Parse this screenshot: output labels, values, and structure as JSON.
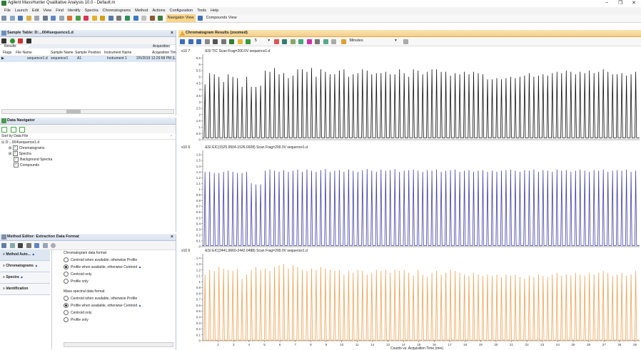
{
  "app": {
    "title": "Agilent MassHunter Qualitative Analysis 10.0 - Default.m",
    "minimize": "–",
    "restore": "❐",
    "close": "✕"
  },
  "menu": [
    "File",
    "Launch",
    "Edit",
    "View",
    "Find",
    "Identify",
    "Spectra",
    "Chromatograms",
    "Method",
    "Actions",
    "Configuration",
    "Tools",
    "Help"
  ],
  "toolbar": {
    "navigator_view": "Navigator View",
    "compounds_view": "Compounds View"
  },
  "sample_table": {
    "title": "Sample Table: D:...004\\sequence1.d",
    "group_results": "Results",
    "group_acquisition": "Acquisition",
    "columns": [
      "Flags",
      "File Name",
      "Sample Name",
      "Sample Position",
      "Instrument Name",
      "Acquisition Tim"
    ],
    "rows": [
      [
        "",
        "sequence1.d",
        "sequence1",
        "A1",
        "Instrument 1",
        "2/5/2019 12:29:58 PM (L"
      ]
    ]
  },
  "data_navigator": {
    "title": "Data Navigator",
    "sort_label": "Sort by Data File",
    "root": "D:...004\\sequence1.d",
    "items": [
      "Chromatograms",
      "Spectra",
      "Background Spectra",
      "Compounds"
    ]
  },
  "method_editor": {
    "title": "Method Editor: Extraction Data Format",
    "nav": [
      "Method Auto...",
      "Chromatograms",
      "Spectra",
      "Identification"
    ],
    "chrom_section": "Chromatogram data format",
    "chrom_options": [
      "Centroid when available, otherwise Profile",
      "Profile when available, otherwise Centroid",
      "Centroid only",
      "Profile only"
    ],
    "chrom_selected": 1,
    "ms_section": "Mass spectral data format",
    "ms_options": [
      "Centroid when available, otherwise Profile",
      "Profile when available, otherwise Centroid",
      "Centroid only",
      "Profile only"
    ],
    "ms_selected": 1
  },
  "chromatogram": {
    "title": "Chromatogram Results (zoomed)",
    "toolbar_number": "5",
    "units_dropdown": "Minutes",
    "x_axis_title": "Counts vs. Acquisition Time (min)",
    "x_ticks": [
      "2",
      "3",
      "4",
      "5",
      "6",
      "7",
      "8",
      "9",
      "10",
      "11",
      "12",
      "13",
      "14",
      "15",
      "16",
      "17",
      "18",
      "19",
      "20",
      "21",
      "22",
      "23",
      "24",
      "25",
      "26",
      "27",
      "28",
      "29"
    ],
    "x_range": [
      1.0,
      29.3
    ]
  },
  "chart_data": [
    {
      "type": "line",
      "title": "-ESI TIC Scan Frag=200.0V sequence1.d",
      "exponent": "x10 7",
      "color": "#111111",
      "y_ticks": [
        "0",
        "0.5",
        "1",
        "1.5",
        "2",
        "2.5",
        "3",
        "3.5",
        "4",
        "4.5",
        "5",
        "5.5",
        "6",
        "6.5"
      ],
      "ylim": [
        0,
        6.7
      ],
      "peak_x": [
        1.15,
        1.45,
        1.75,
        2.05,
        2.35,
        2.65,
        2.95,
        3.25,
        3.55,
        3.85,
        4.15,
        4.45,
        4.75,
        5.05,
        5.35,
        5.65,
        5.95,
        6.25,
        6.55,
        6.85,
        7.15,
        7.45,
        7.75,
        8.05,
        8.35,
        8.65,
        8.95,
        9.25,
        9.55,
        9.85,
        10.15,
        10.45,
        10.75,
        11.05,
        11.35,
        11.65,
        11.95,
        12.25,
        12.55,
        12.85,
        13.15,
        13.45,
        13.75,
        14.05,
        14.35,
        14.65,
        14.95,
        15.25,
        15.55,
        15.85,
        16.15,
        16.45,
        16.75,
        17.05,
        17.35,
        17.65,
        17.95,
        18.25,
        18.55,
        18.85,
        19.15,
        19.45,
        19.75,
        20.05,
        20.35,
        20.65,
        20.95,
        21.25,
        21.55,
        21.85,
        22.15,
        22.45,
        22.75,
        23.05,
        23.35,
        23.65,
        23.95,
        24.25,
        24.55,
        24.85,
        25.15,
        25.45,
        25.75,
        26.05,
        26.35,
        26.65,
        26.95,
        27.25,
        27.55,
        27.85,
        28.15,
        28.45,
        28.75,
        29.05
      ],
      "peak_y": [
        4.4,
        5.3,
        5.2,
        5.0,
        4.6,
        5.2,
        5.0,
        4.9,
        4.2,
        5.0,
        4.2,
        4.2,
        4.3,
        5.5,
        5.4,
        5.7,
        5.2,
        5.3,
        4.9,
        5.1,
        5.6,
        5.6,
        5.4,
        5.7,
        5.0,
        5.6,
        5.4,
        5.2,
        5.2,
        5.5,
        5.6,
        5.0,
        5.2,
        5.3,
        5.6,
        5.5,
        5.2,
        5.3,
        5.3,
        5.4,
        5.2,
        5.2,
        5.6,
        5.3,
        5.0,
        5.6,
        5.5,
        5.2,
        5.4,
        5.6,
        5.6,
        5.4,
        5.4,
        5.1,
        5.3,
        5.2,
        5.4,
        5.2,
        5.4,
        5.3,
        5.2,
        4.8,
        4.8,
        4.9,
        4.8,
        4.9,
        5.0,
        4.9,
        5.0,
        5.1,
        5.3,
        5.0,
        5.1,
        5.2,
        5.1,
        5.3,
        5.4,
        5.3,
        5.5,
        5.4,
        5.2,
        5.4,
        5.3,
        5.5,
        5.3,
        5.4,
        5.6,
        5.4,
        5.2,
        5.2,
        5.3,
        5.1,
        5.2,
        5.4
      ],
      "baseline": 0.15
    },
    {
      "type": "line",
      "title": "-ESI EIC(1525.9504-1526.0928) Scan Frag=200.0V sequence1.d",
      "exponent": "x10 6",
      "color": "#3f3fa8",
      "y_ticks": [
        "0",
        "0.1",
        "0.2",
        "0.3",
        "0.4",
        "0.5",
        "0.6",
        "0.7",
        "0.8",
        "0.9",
        "1",
        "1.1",
        "1.2",
        "1.3",
        "1.4",
        "1.5",
        "1.6"
      ],
      "ylim": [
        0,
        1.65
      ],
      "peak_x": [
        1.15,
        1.45,
        1.75,
        2.05,
        2.35,
        2.65,
        2.95,
        3.25,
        3.55,
        3.85,
        4.15,
        4.45,
        4.75,
        5.05,
        5.35,
        5.65,
        5.95,
        6.25,
        6.55,
        6.85,
        7.15,
        7.45,
        7.75,
        8.05,
        8.35,
        8.65,
        8.95,
        9.25,
        9.55,
        9.85,
        10.15,
        10.45,
        10.75,
        11.05,
        11.35,
        11.65,
        11.95,
        12.25,
        12.55,
        12.85,
        13.15,
        13.45,
        13.75,
        14.05,
        14.35,
        14.65,
        14.95,
        15.25,
        15.55,
        15.85,
        16.15,
        16.45,
        16.75,
        17.05,
        17.35,
        17.65,
        17.95,
        18.25,
        18.55,
        18.85,
        19.15,
        19.45,
        19.75,
        20.05,
        20.35,
        20.65,
        20.95,
        21.25,
        21.55,
        21.85,
        22.15,
        22.45,
        22.75,
        23.05,
        23.35,
        23.65,
        23.95,
        24.25,
        24.55,
        24.85,
        25.15,
        25.45,
        25.75,
        26.05,
        26.35,
        26.65,
        26.95,
        27.25,
        27.55,
        27.85,
        28.15,
        28.45,
        28.75,
        29.05
      ],
      "peak_y": [
        1.3,
        1.3,
        1.28,
        1.28,
        1.3,
        1.32,
        1.3,
        1.28,
        1.28,
        1.3,
        1.1,
        1.08,
        1.08,
        1.32,
        1.34,
        1.32,
        1.3,
        1.33,
        1.3,
        1.32,
        1.34,
        1.3,
        1.34,
        1.32,
        1.3,
        1.33,
        1.35,
        1.3,
        1.32,
        1.33,
        1.3,
        1.34,
        1.32,
        1.3,
        1.33,
        1.35,
        1.32,
        1.3,
        1.34,
        1.32,
        1.33,
        1.35,
        1.3,
        1.32,
        1.33,
        1.34,
        1.32,
        1.3,
        1.33,
        1.32,
        1.34,
        1.3,
        1.32,
        1.33,
        1.34,
        1.3,
        1.32,
        1.33,
        1.3,
        1.32,
        1.33,
        1.3,
        1.32,
        1.3,
        1.32,
        1.33,
        1.34,
        1.32,
        1.3,
        1.33,
        1.32,
        1.34,
        1.3,
        1.33,
        1.32,
        1.3,
        1.34,
        1.32,
        1.33,
        1.3,
        1.32,
        1.34,
        1.32,
        1.3,
        1.33,
        1.32,
        1.34,
        1.3,
        1.32,
        1.33,
        1.32,
        1.34,
        1.3,
        1.32
      ],
      "baseline": 0.02
    },
    {
      "type": "line",
      "title": "-ESI EIC(2441.9660-2442.0488) Scan Frag=200.0V sequence1.d",
      "exponent": "x10 6",
      "color": "#f0a050",
      "y_ticks": [
        "0",
        "0.1",
        "0.2",
        "0.3",
        "0.4",
        "0.5",
        "0.6",
        "0.7",
        "0.8",
        "0.9",
        "1",
        "1.1",
        "1.2",
        "1.3",
        "1.4"
      ],
      "ylim": [
        0,
        1.45
      ],
      "peak_x": [
        1.15,
        1.45,
        1.75,
        2.05,
        2.35,
        2.65,
        2.95,
        3.25,
        3.55,
        3.85,
        4.15,
        4.45,
        4.75,
        5.05,
        5.35,
        5.65,
        5.95,
        6.25,
        6.55,
        6.85,
        7.15,
        7.45,
        7.75,
        8.05,
        8.35,
        8.65,
        8.95,
        9.25,
        9.55,
        9.85,
        10.15,
        10.45,
        10.75,
        11.05,
        11.35,
        11.65,
        11.95,
        12.25,
        12.55,
        12.85,
        13.15,
        13.45,
        13.75,
        14.05,
        14.35,
        14.65,
        14.95,
        15.25,
        15.55,
        15.85,
        16.15,
        16.45,
        16.75,
        17.05,
        17.35,
        17.65,
        17.95,
        18.25,
        18.55,
        18.85,
        19.15,
        19.45,
        19.75,
        20.05,
        20.35,
        20.65,
        20.95,
        21.25,
        21.55,
        21.85,
        22.15,
        22.45,
        22.75,
        23.05,
        23.35,
        23.65,
        23.95,
        24.25,
        24.55,
        24.85,
        25.15,
        25.45,
        25.75,
        26.05,
        26.35,
        26.65,
        26.95,
        27.25,
        27.55,
        27.85,
        28.15,
        28.45,
        28.75,
        29.05
      ],
      "peak_y": [
        1.12,
        1.2,
        1.18,
        1.25,
        1.22,
        1.2,
        1.18,
        1.22,
        1.05,
        1.12,
        1.2,
        1.25,
        1.2,
        1.22,
        1.18,
        1.25,
        1.28,
        1.3,
        1.22,
        1.28,
        1.25,
        1.2,
        1.18,
        1.22,
        1.2,
        1.25,
        1.22,
        1.2,
        1.18,
        1.2,
        1.12,
        1.18,
        1.15,
        1.2,
        1.18,
        1.12,
        1.15,
        1.2,
        1.18,
        1.2,
        1.15,
        1.2,
        1.18,
        1.2,
        1.15,
        1.1,
        1.2,
        1.12,
        1.08,
        1.15,
        1.18,
        1.12,
        1.15,
        1.2,
        1.18,
        1.15,
        1.12,
        1.1,
        1.15,
        1.12,
        1.1,
        1.12,
        1.1,
        1.12,
        1.08,
        1.12,
        1.1,
        1.12,
        1.08,
        1.05,
        1.1,
        1.08,
        1.12,
        1.1,
        1.08,
        1.12,
        1.15,
        1.1,
        1.12,
        1.1,
        1.15,
        1.12,
        1.1,
        1.15,
        1.12,
        1.15,
        1.18,
        1.15,
        1.1,
        1.12,
        1.15,
        1.1,
        1.12,
        1.18
      ],
      "baseline": 0.01
    }
  ]
}
